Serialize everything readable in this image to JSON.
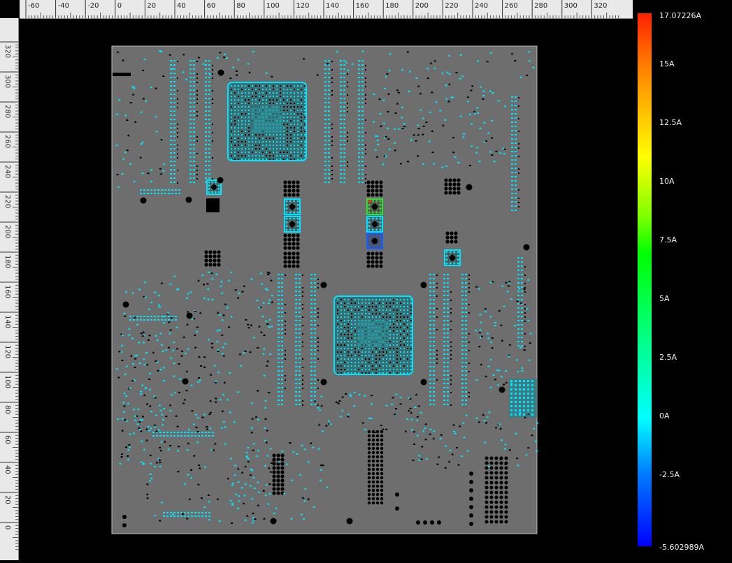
{
  "ruler": {
    "unit_ticks_h": [
      "-60",
      "-40",
      "-20",
      "0",
      "20",
      "40",
      "60",
      "80",
      "100",
      "120",
      "140",
      "160",
      "180",
      "200",
      "220",
      "240",
      "260",
      "280",
      "300",
      "320"
    ],
    "unit_ticks_v": [
      "320",
      "300",
      "280",
      "260",
      "240",
      "220",
      "200",
      "180",
      "160",
      "140",
      "120",
      "100",
      "80",
      "60",
      "40",
      "20",
      "0"
    ]
  },
  "legend": {
    "max_label": "17.07226A",
    "min_label": "-5.602989A",
    "ticks": [
      "15A",
      "12.5A",
      "10A",
      "7.5A",
      "5A",
      "2.5A",
      "0A",
      "-2.5A"
    ],
    "colors": {
      "top": "#ff2000",
      "high": "#ffff00",
      "mid_high": "#00ff00",
      "zero": "#00ffff",
      "bottom": "#0000ff"
    }
  },
  "board": {
    "background": "#6e6e6e",
    "pad_color": "#00e5ff",
    "via_color": "#000000"
  }
}
